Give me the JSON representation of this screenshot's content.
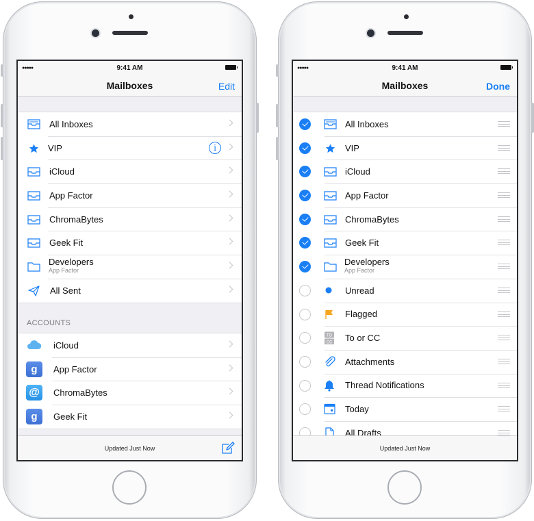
{
  "status": {
    "time": "9:41 AM",
    "signal": "●●●●●"
  },
  "left": {
    "nav_title": "Mailboxes",
    "edit_label": "Edit",
    "mailboxes": [
      {
        "label": "All Inboxes",
        "icon": "tray-stack-icon"
      },
      {
        "label": "VIP",
        "icon": "star-icon"
      },
      {
        "label": "iCloud",
        "icon": "inbox-icon"
      },
      {
        "label": "App Factor",
        "icon": "inbox-icon"
      },
      {
        "label": "ChromaBytes",
        "icon": "inbox-icon"
      },
      {
        "label": "Geek Fit",
        "icon": "inbox-icon"
      },
      {
        "label": "Developers",
        "sublabel": "App Factor",
        "icon": "folder-icon"
      },
      {
        "label": "All Sent",
        "icon": "paper-plane-icon"
      }
    ],
    "accounts_header": "ACCOUNTS",
    "accounts": [
      {
        "label": "iCloud",
        "icon": "icloud-icon"
      },
      {
        "label": "App Factor",
        "icon": "google-icon"
      },
      {
        "label": "ChromaBytes",
        "icon": "at-icon"
      },
      {
        "label": "Geek Fit",
        "icon": "google-icon"
      }
    ],
    "google_glyph": "g",
    "at_glyph": "@",
    "info_glyph": "i",
    "toolbar_text": "Updated Just Now"
  },
  "right": {
    "nav_title": "Mailboxes",
    "done_label": "Done",
    "items": [
      {
        "label": "All Inboxes",
        "checked": true,
        "icon": "tray-stack-icon"
      },
      {
        "label": "VIP",
        "checked": true,
        "icon": "star-icon"
      },
      {
        "label": "iCloud",
        "checked": true,
        "icon": "inbox-icon"
      },
      {
        "label": "App Factor",
        "checked": true,
        "icon": "inbox-icon"
      },
      {
        "label": "ChromaBytes",
        "checked": true,
        "icon": "inbox-icon"
      },
      {
        "label": "Geek Fit",
        "checked": true,
        "icon": "inbox-icon"
      },
      {
        "label": "Developers",
        "sublabel": "App Factor",
        "checked": true,
        "icon": "folder-icon"
      },
      {
        "label": "Unread",
        "checked": false,
        "icon": "unread-dot-icon"
      },
      {
        "label": "Flagged",
        "checked": false,
        "icon": "flag-icon"
      },
      {
        "label": "To or CC",
        "checked": false,
        "icon": "to-cc-icon"
      },
      {
        "label": "Attachments",
        "checked": false,
        "icon": "paperclip-icon"
      },
      {
        "label": "Thread Notifications",
        "checked": false,
        "icon": "bell-icon"
      },
      {
        "label": "Today",
        "checked": false,
        "icon": "calendar-icon"
      },
      {
        "label": "All Drafts",
        "checked": false,
        "icon": "document-icon"
      }
    ],
    "to_cc_glyphs": [
      "TO",
      "CC"
    ],
    "toolbar_text": "Updated Just Now"
  },
  "colors": {
    "accent": "#1a7ff5",
    "flag": "#f5a623",
    "separator": "#e0e0e4"
  }
}
